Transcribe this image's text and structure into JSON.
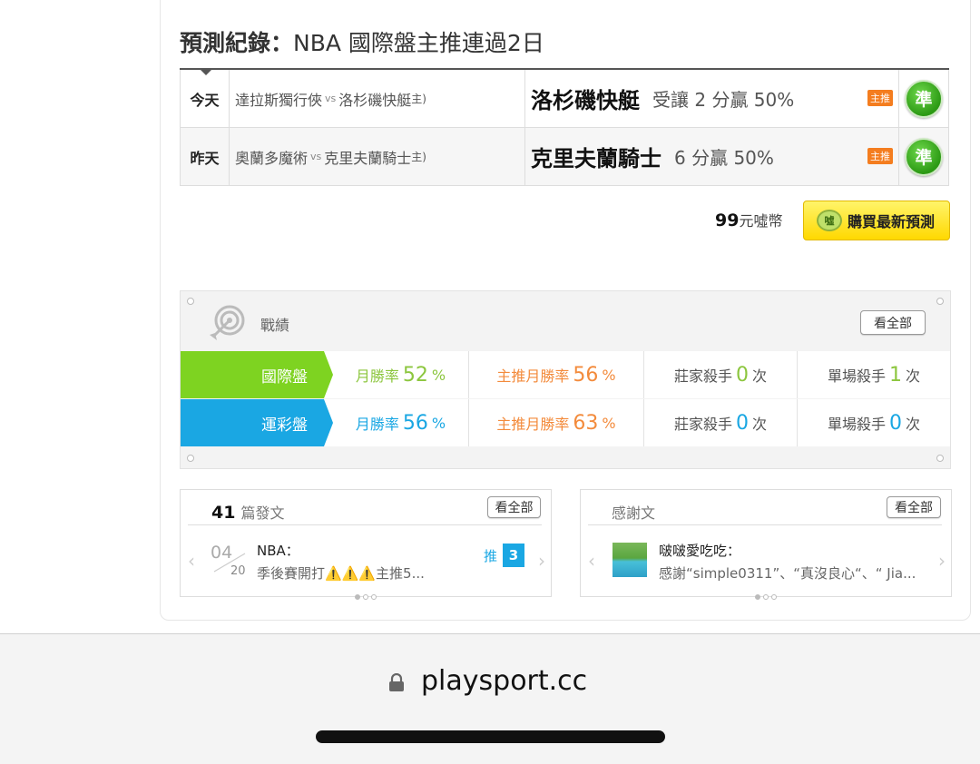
{
  "prediction": {
    "title_bold": "預測紀錄：",
    "title_rest": "NBA 國際盤主推連過2日",
    "rows": [
      {
        "day": "今天",
        "away": "達拉斯獨行俠",
        "vs": "vs",
        "home": "洛杉磯快艇",
        "home_mark": "主)",
        "pick": "洛杉磯快艇",
        "odds": "受讓 2 分贏 50%",
        "tag": "主推",
        "result": "準"
      },
      {
        "day": "昨天",
        "away": "奧蘭多魔術",
        "vs": "vs",
        "home": "克里夫蘭騎士",
        "home_mark": "主)",
        "pick": "克里夫蘭騎士",
        "odds": "6 分贏 50%",
        "tag": "主推",
        "result": "準"
      }
    ]
  },
  "purchase": {
    "price_num": "99",
    "price_unit": "元噓幣",
    "coin": "噓",
    "button": "購買最新預測"
  },
  "stats": {
    "title": "戰績",
    "view_all": "看全部",
    "rows": [
      {
        "label": "國際盤",
        "color": "#7ed321",
        "c1_label": "月勝率",
        "c1_val": "52",
        "c1_unit": "%",
        "c2_label": "主推月勝率",
        "c2_val": "56",
        "c2_unit": "%",
        "c3_label": "莊家殺手",
        "c3_val": "0",
        "c3_unit": "次",
        "c4_label": "單場殺手",
        "c4_val": "1",
        "c4_unit": "次"
      },
      {
        "label": "運彩盤",
        "color": "#1aa7e3",
        "c1_label": "月勝率",
        "c1_val": "56",
        "c1_unit": "%",
        "c2_label": "主推月勝率",
        "c2_val": "63",
        "c2_unit": "%",
        "c3_label": "莊家殺手",
        "c3_val": "0",
        "c3_unit": "次",
        "c4_label": "單場殺手",
        "c4_val": "0",
        "c4_unit": "次"
      }
    ]
  },
  "posts": {
    "count": "41",
    "label": "篇發文",
    "view_all": "看全部",
    "item": {
      "month": "04",
      "day": "20",
      "title": "NBA：",
      "snippet": "季後賽開打⚠️⚠️⚠️主推5...",
      "push_label": "推",
      "push_count": "3"
    }
  },
  "thanks": {
    "label": "感謝文",
    "view_all": "看全部",
    "item": {
      "title": "啵啵愛吃吃：",
      "snippet": "感謝“simple0311”、“真沒良心“、“ Jia..."
    }
  },
  "browser": {
    "url": "playsport.cc"
  }
}
